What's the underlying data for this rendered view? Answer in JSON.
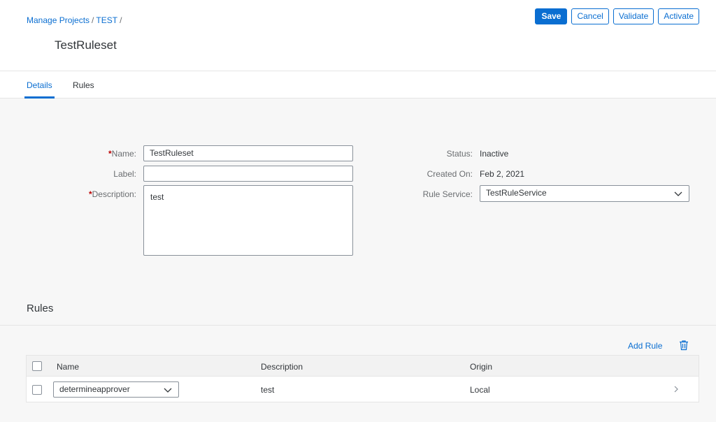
{
  "breadcrumb": {
    "items": [
      "Manage Projects",
      "TEST"
    ],
    "separator": "/"
  },
  "page": {
    "title": "TestRuleset"
  },
  "actions": {
    "save": "Save",
    "cancel": "Cancel",
    "validate": "Validate",
    "activate": "Activate"
  },
  "tabs": [
    {
      "label": "Details",
      "active": true
    },
    {
      "label": "Rules",
      "active": false
    }
  ],
  "form": {
    "required_marker": "*",
    "name_label": "Name:",
    "name_value": "TestRuleset",
    "label_label": "Label:",
    "label_value": "",
    "description_label": "Description:",
    "description_value": "test",
    "status_label": "Status:",
    "status_value": "Inactive",
    "created_label": "Created On:",
    "created_value": "Feb 2, 2021",
    "service_label": "Rule Service:",
    "service_value": "TestRuleService"
  },
  "rules_section": {
    "title": "Rules",
    "add_rule": "Add Rule",
    "columns": [
      "Name",
      "Description",
      "Origin"
    ],
    "rows": [
      {
        "name": "determineapprover",
        "description": "test",
        "origin": "Local"
      }
    ]
  },
  "icons": {
    "chevron": "chevron-down-icon",
    "trash": "trash-icon",
    "row_nav": "chevron-right-icon"
  },
  "colors": {
    "accent": "#0a6ed1",
    "required": "#bb0000",
    "background": "#f7f7f7"
  }
}
